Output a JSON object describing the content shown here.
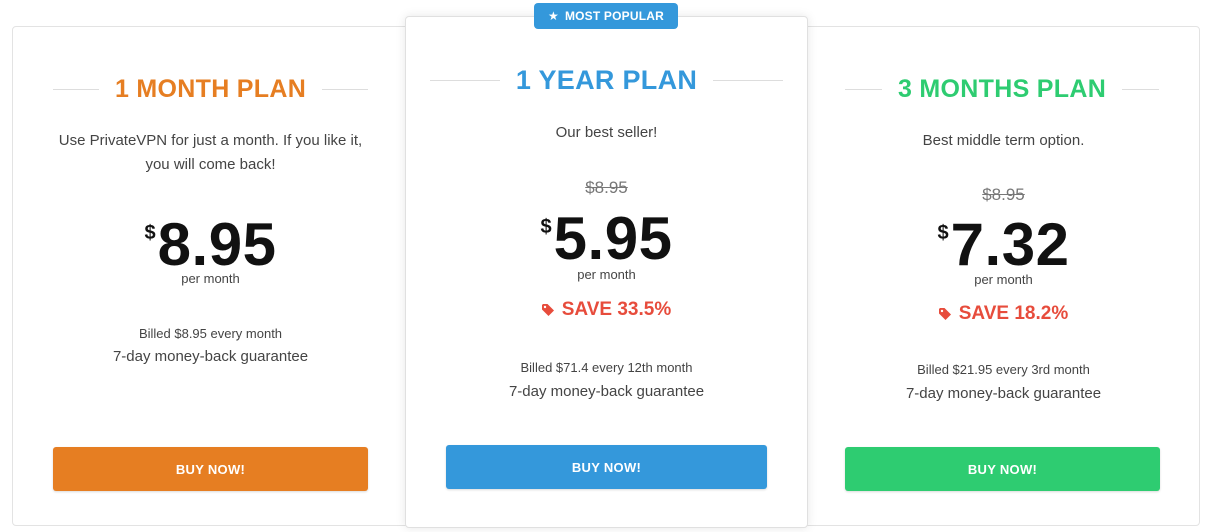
{
  "badge": {
    "label": "MOST POPULAR",
    "icon": "star-icon",
    "color": "#3498db"
  },
  "plans": [
    {
      "title": "1 MONTH PLAN",
      "accent": "#e67e22",
      "description": "Use PrivateVPN for just a month. If you like it, you will come back!",
      "old_price": "",
      "currency": "$",
      "price": "8.95",
      "period": "per month",
      "save": "",
      "billed": "Billed $8.95 every month",
      "guarantee": "7-day money-back guarantee",
      "button": "BUY NOW!"
    },
    {
      "title": "1 YEAR PLAN",
      "accent": "#3498db",
      "description": "Our best seller!",
      "old_price": "$8.95",
      "currency": "$",
      "price": "5.95",
      "period": "per month",
      "save": "SAVE 33.5%",
      "billed": "Billed $71.4 every 12th month",
      "guarantee": "7-day money-back guarantee",
      "button": "BUY NOW!"
    },
    {
      "title": "3 MONTHS PLAN",
      "accent": "#2ecc71",
      "description": "Best middle term option.",
      "old_price": "$8.95",
      "currency": "$",
      "price": "7.32",
      "period": "per month",
      "save": "SAVE 18.2%",
      "billed": "Billed $21.95 every 3rd month",
      "guarantee": "7-day money-back guarantee",
      "button": "BUY NOW!"
    }
  ],
  "save_color": "#e74c3c"
}
